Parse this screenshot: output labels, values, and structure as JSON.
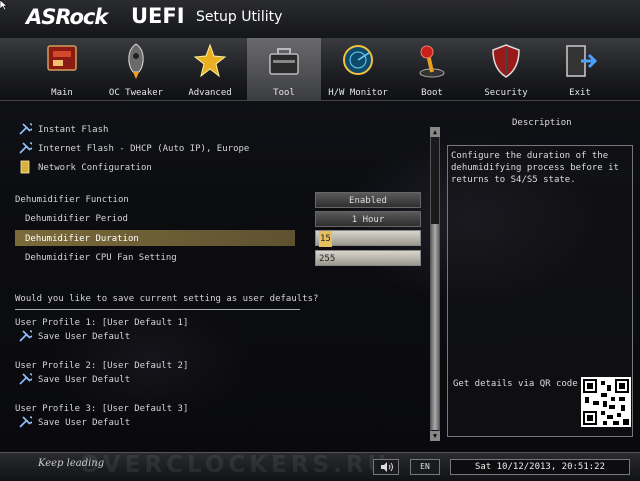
{
  "header": {
    "brand": "ASRock",
    "product": "UEFI",
    "subtitle": "Setup Utility"
  },
  "tabs": [
    {
      "label": "Main"
    },
    {
      "label": "OC Tweaker"
    },
    {
      "label": "Advanced"
    },
    {
      "label": "Tool"
    },
    {
      "label": "H/W Monitor"
    },
    {
      "label": "Boot"
    },
    {
      "label": "Security"
    },
    {
      "label": "Exit"
    }
  ],
  "active_tab": "Tool",
  "menu": {
    "instant_flash": "Instant Flash",
    "internet_flash": "Internet Flash - DHCP (Auto IP), Europe",
    "network_config": "Network Configuration"
  },
  "settings": {
    "function": {
      "label": "Dehumidifier Function",
      "value": "Enabled"
    },
    "period": {
      "label": "Dehumidifier Period",
      "value": "1 Hour"
    },
    "duration": {
      "label": "Dehumidifier Duration",
      "value": "15"
    },
    "cpu_fan": {
      "label": "Dehumidifier CPU Fan Setting",
      "value": "255"
    }
  },
  "profiles": {
    "question": "Would you like to save current setting as user defaults?",
    "items": [
      {
        "title": "User Profile 1: [User Default 1]",
        "action": "Save User Default"
      },
      {
        "title": "User Profile 2: [User Default 2]",
        "action": "Save User Default"
      },
      {
        "title": "User Profile 3: [User Default 3]",
        "action": "Save User Default"
      }
    ]
  },
  "description": {
    "title": "Description",
    "text": "Configure the duration of the dehumidifying process before it returns to S4/S5 state.",
    "qr_label": "Get details via QR code"
  },
  "footer": {
    "slogan": "Keep leading",
    "watermark": "OVERCLOCKERS.RU",
    "language": "EN",
    "datetime": "Sat 10/12/2013, 20:51:22"
  },
  "colors": {
    "highlight": "#7a6a3a",
    "background": "#0b0c10",
    "accent": "#e4c060"
  }
}
